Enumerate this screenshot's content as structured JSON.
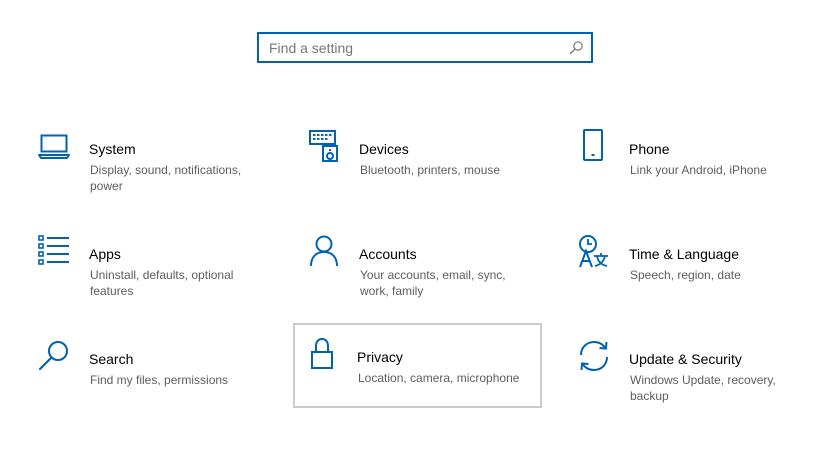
{
  "search": {
    "placeholder": "Find a setting",
    "value": ""
  },
  "accent_color": "#0063b1",
  "tiles": [
    {
      "icon": "laptop-icon",
      "title": "System",
      "desc": "Display, sound, notifications, power"
    },
    {
      "icon": "devices-icon",
      "title": "Devices",
      "desc": "Bluetooth, printers, mouse"
    },
    {
      "icon": "phone-icon",
      "title": "Phone",
      "desc": "Link your Android, iPhone"
    },
    {
      "icon": "apps-list-icon",
      "title": "Apps",
      "desc": "Uninstall, defaults, optional features"
    },
    {
      "icon": "person-icon",
      "title": "Accounts",
      "desc": "Your accounts, email, sync, work, family"
    },
    {
      "icon": "time-language-icon",
      "title": "Time & Language",
      "desc": "Speech, region, date"
    },
    {
      "icon": "search-icon",
      "title": "Search",
      "desc": "Find my files, permissions"
    },
    {
      "icon": "lock-icon",
      "title": "Privacy",
      "desc": "Location, camera, microphone"
    },
    {
      "icon": "sync-arrows-icon",
      "title": "Update & Security",
      "desc": "Windows Update, recovery, backup"
    }
  ]
}
